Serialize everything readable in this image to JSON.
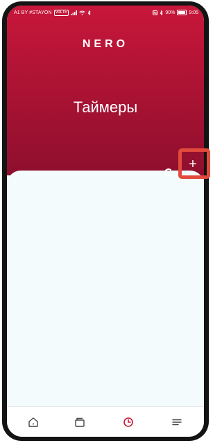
{
  "status_bar": {
    "carrier": "A1 BY #STAYON",
    "carrier_badge": "VoLTE",
    "right": "90%",
    "time": "9:05"
  },
  "header": {
    "logo": "NERO",
    "title": "Таймеры",
    "accent_color": "#b3123a"
  },
  "actions": {
    "add_label": "+"
  },
  "tabbar": {
    "items": [
      {
        "icon": "home-icon"
      },
      {
        "icon": "cards-icon"
      },
      {
        "icon": "clock-icon",
        "active": true
      },
      {
        "icon": "menu-icon"
      }
    ],
    "active_color": "#c8173a"
  }
}
